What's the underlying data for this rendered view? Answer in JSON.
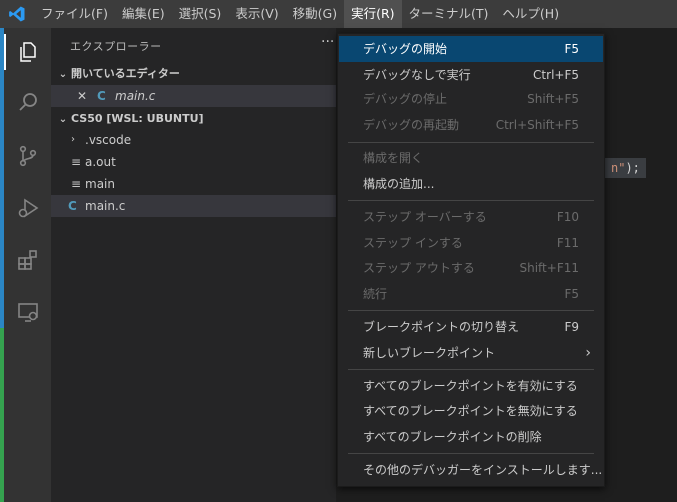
{
  "menubar": {
    "items": [
      "ファイル(F)",
      "編集(E)",
      "選択(S)",
      "表示(V)",
      "移動(G)",
      "実行(R)",
      "ターミナル(T)",
      "ヘルプ(H)"
    ],
    "active_index": 5
  },
  "sidebar": {
    "title": "エクスプローラー",
    "more": "···",
    "open_editors": {
      "header": "開いているエディター",
      "files": [
        {
          "close": "✕",
          "icon": "C",
          "name": "main.c"
        }
      ]
    },
    "workspace": {
      "header": "CS50 [WSL: UBUNTU]",
      "items": [
        {
          "name": ".vscode",
          "kind": "folder"
        },
        {
          "name": "a.out",
          "kind": "file"
        },
        {
          "name": "main",
          "kind": "file"
        },
        {
          "name": "main.c",
          "kind": "c-file"
        }
      ]
    }
  },
  "editor": {
    "fragment_str": "n\"",
    "fragment_rest": ");"
  },
  "run_menu": {
    "items": [
      {
        "label": "デバッグの開始",
        "key": "F5",
        "state": "highlighted"
      },
      {
        "label": "デバッグなしで実行",
        "key": "Ctrl+F5",
        "state": "enabled"
      },
      {
        "label": "デバッグの停止",
        "key": "Shift+F5",
        "state": "disabled"
      },
      {
        "label": "デバッグの再起動",
        "key": "Ctrl+Shift+F5",
        "state": "disabled"
      },
      {
        "label": "構成を開く",
        "key": "",
        "state": "disabled"
      },
      {
        "label": "構成の追加...",
        "key": "",
        "state": "enabled"
      },
      {
        "label": "ステップ オーバーする",
        "key": "F10",
        "state": "disabled"
      },
      {
        "label": "ステップ インする",
        "key": "F11",
        "state": "disabled"
      },
      {
        "label": "ステップ アウトする",
        "key": "Shift+F11",
        "state": "disabled"
      },
      {
        "label": "続行",
        "key": "F5",
        "state": "disabled"
      },
      {
        "label": "ブレークポイントの切り替え",
        "key": "F9",
        "state": "enabled"
      },
      {
        "label": "新しいブレークポイント",
        "key": "",
        "state": "enabled",
        "submenu": "›"
      },
      {
        "label": "すべてのブレークポイントを有効にする",
        "key": "",
        "state": "enabled"
      },
      {
        "label": "すべてのブレークポイントを無効にする",
        "key": "",
        "state": "enabled"
      },
      {
        "label": "すべてのブレークポイントの削除",
        "key": "",
        "state": "enabled"
      },
      {
        "label": "その他のデバッガーをインストールします...",
        "key": "",
        "state": "enabled"
      }
    ]
  },
  "colors": {
    "accent": "#094771",
    "vscode_blue": "#2b86c5",
    "menubar": "#3c3c3c",
    "sidebar": "#252526",
    "activitybar": "#333333"
  },
  "icons": [
    "vscode-logo-icon",
    "explorer-icon",
    "search-icon",
    "source-control-icon",
    "run-debug-icon",
    "extensions-icon",
    "remote-explorer-icon",
    "chevron-down-icon",
    "close-icon",
    "c-file-icon",
    "file-lines-icon",
    "chevron-right-icon"
  ]
}
